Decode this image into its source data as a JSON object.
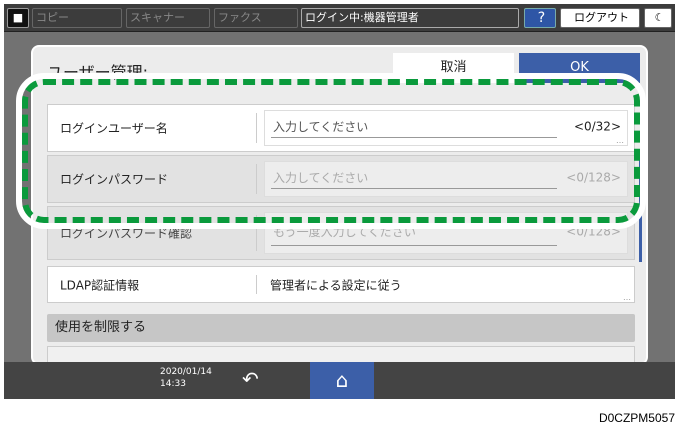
{
  "topbar": {
    "copy": "コピー",
    "scanner": "スキャナー",
    "fax": "ファクス",
    "login_status": "ログイン中:機器管理者",
    "help": "?",
    "logout": "ログアウト",
    "user_icon": "user-icon",
    "moon_icon": "moon-icon"
  },
  "dialog": {
    "title": "ユーザー管理:",
    "cancel": "取消",
    "ok": "OK"
  },
  "rows": [
    {
      "label": "ログインユーザー名",
      "placeholder": "入力してください",
      "count": "<0/32>"
    },
    {
      "label": "ログインパスワード",
      "placeholder": "入力してください",
      "count": "<0/128>"
    },
    {
      "label": "ログインパスワード確認",
      "placeholder": "もう一度入力してください",
      "count": "<0/128>"
    },
    {
      "label": "LDAP認証情報",
      "value": "管理者による設定に従う"
    }
  ],
  "section": "使用を制限する",
  "bottombar": {
    "date": "2020/01/14",
    "time": "14:33"
  },
  "highlight_color": "#0a9a3c",
  "caption": "D0CZPM5057"
}
